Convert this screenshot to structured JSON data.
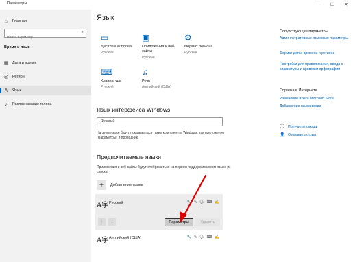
{
  "window": {
    "title": "Параметры",
    "controls": [
      "—",
      "☐",
      "✕"
    ]
  },
  "sidebar": {
    "home_label": "Главная",
    "search_placeholder": "Найти параметр",
    "section_label": "Время и язык",
    "items": [
      {
        "label": "Дата и время",
        "icon": "calendar-icon"
      },
      {
        "label": "Регион",
        "icon": "globe-icon"
      },
      {
        "label": "Язык",
        "icon": "language-icon",
        "active": true
      },
      {
        "label": "Распознавание голоса",
        "icon": "microphone-icon"
      }
    ]
  },
  "main": {
    "title": "Язык",
    "tiles": [
      {
        "label": "Дисплей Windows",
        "sub": "Русский",
        "icon": "monitor-icon"
      },
      {
        "label": "Приложения и веб-сайты",
        "sub": "Русский",
        "icon": "apps-icon"
      },
      {
        "label": "Формат региона",
        "sub": "Русский",
        "icon": "format-region-icon"
      },
      {
        "label": "Клавиатура",
        "sub": "Русский",
        "icon": "keyboard-icon"
      },
      {
        "label": "Речь",
        "sub": "Английский (США)",
        "icon": "microphone-icon"
      }
    ],
    "interface_heading": "Язык интерфейса Windows",
    "interface_value": "Русский",
    "interface_desc": "На этом языке будут показываться такие компоненты Windows, как приложение \"Параметры\" и проводник.",
    "preferred_heading": "Предпочитаемые языки",
    "preferred_desc": "Приложения и веб-сайты будут отображаться на первом поддерживаемом языке из списка.",
    "add_language_label": "Добавление языка",
    "languages": [
      {
        "name": "Русский",
        "features": "🔧 ✎ 🗣 ⌨ ✍"
      },
      {
        "name": "Английский (США)",
        "features": "🔧 ✎ 🗣 ⌨ ✍"
      }
    ],
    "options_button": "Параметры",
    "remove_button": "Удалить"
  },
  "right_panel": {
    "related_heading": "Сопутствующие параметры",
    "related_links": [
      "Административные языковые параметры",
      "Формат даты, времени и региона",
      "Настройки для правописания, ввода с клавиатуры и проверки орфографии"
    ],
    "help_heading": "Справка в Интернете",
    "help_links": [
      "Изменение языка Microsoft Store",
      "Добавление языка ввода"
    ],
    "get_help": "Получить помощь",
    "feedback": "Отправить отзыв"
  },
  "colors": {
    "accent": "#0063b1",
    "sidebar_bg": "#f2f2f2",
    "arrow": "#e00000"
  }
}
